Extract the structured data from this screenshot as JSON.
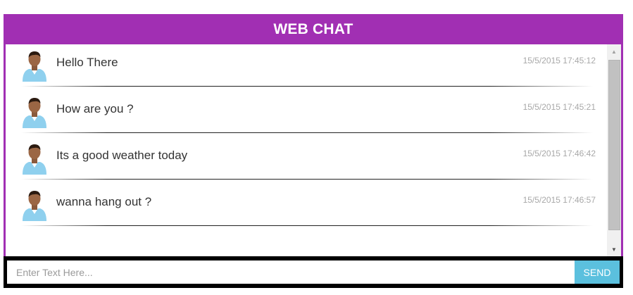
{
  "header": {
    "title": "WEB CHAT"
  },
  "messages": [
    {
      "text": "Hello There",
      "time": "15/5/2015 17:45:12",
      "avatar_icon": "user-avatar-icon"
    },
    {
      "text": "How are you ?",
      "time": "15/5/2015 17:45:21",
      "avatar_icon": "user-avatar-icon"
    },
    {
      "text": "Its a good weather today",
      "time": "15/5/2015 17:46:42",
      "avatar_icon": "user-avatar-icon"
    },
    {
      "text": "wanna hang out ?",
      "time": "15/5/2015 17:46:57",
      "avatar_icon": "user-avatar-icon"
    }
  ],
  "input": {
    "placeholder": "Enter Text Here...",
    "value": ""
  },
  "send": {
    "label": "SEND"
  },
  "colors": {
    "header_bg": "#a12fb3",
    "send_bg": "#5bc0de",
    "input_bar_bg": "#000000",
    "timestamp": "#a8a8a8"
  }
}
